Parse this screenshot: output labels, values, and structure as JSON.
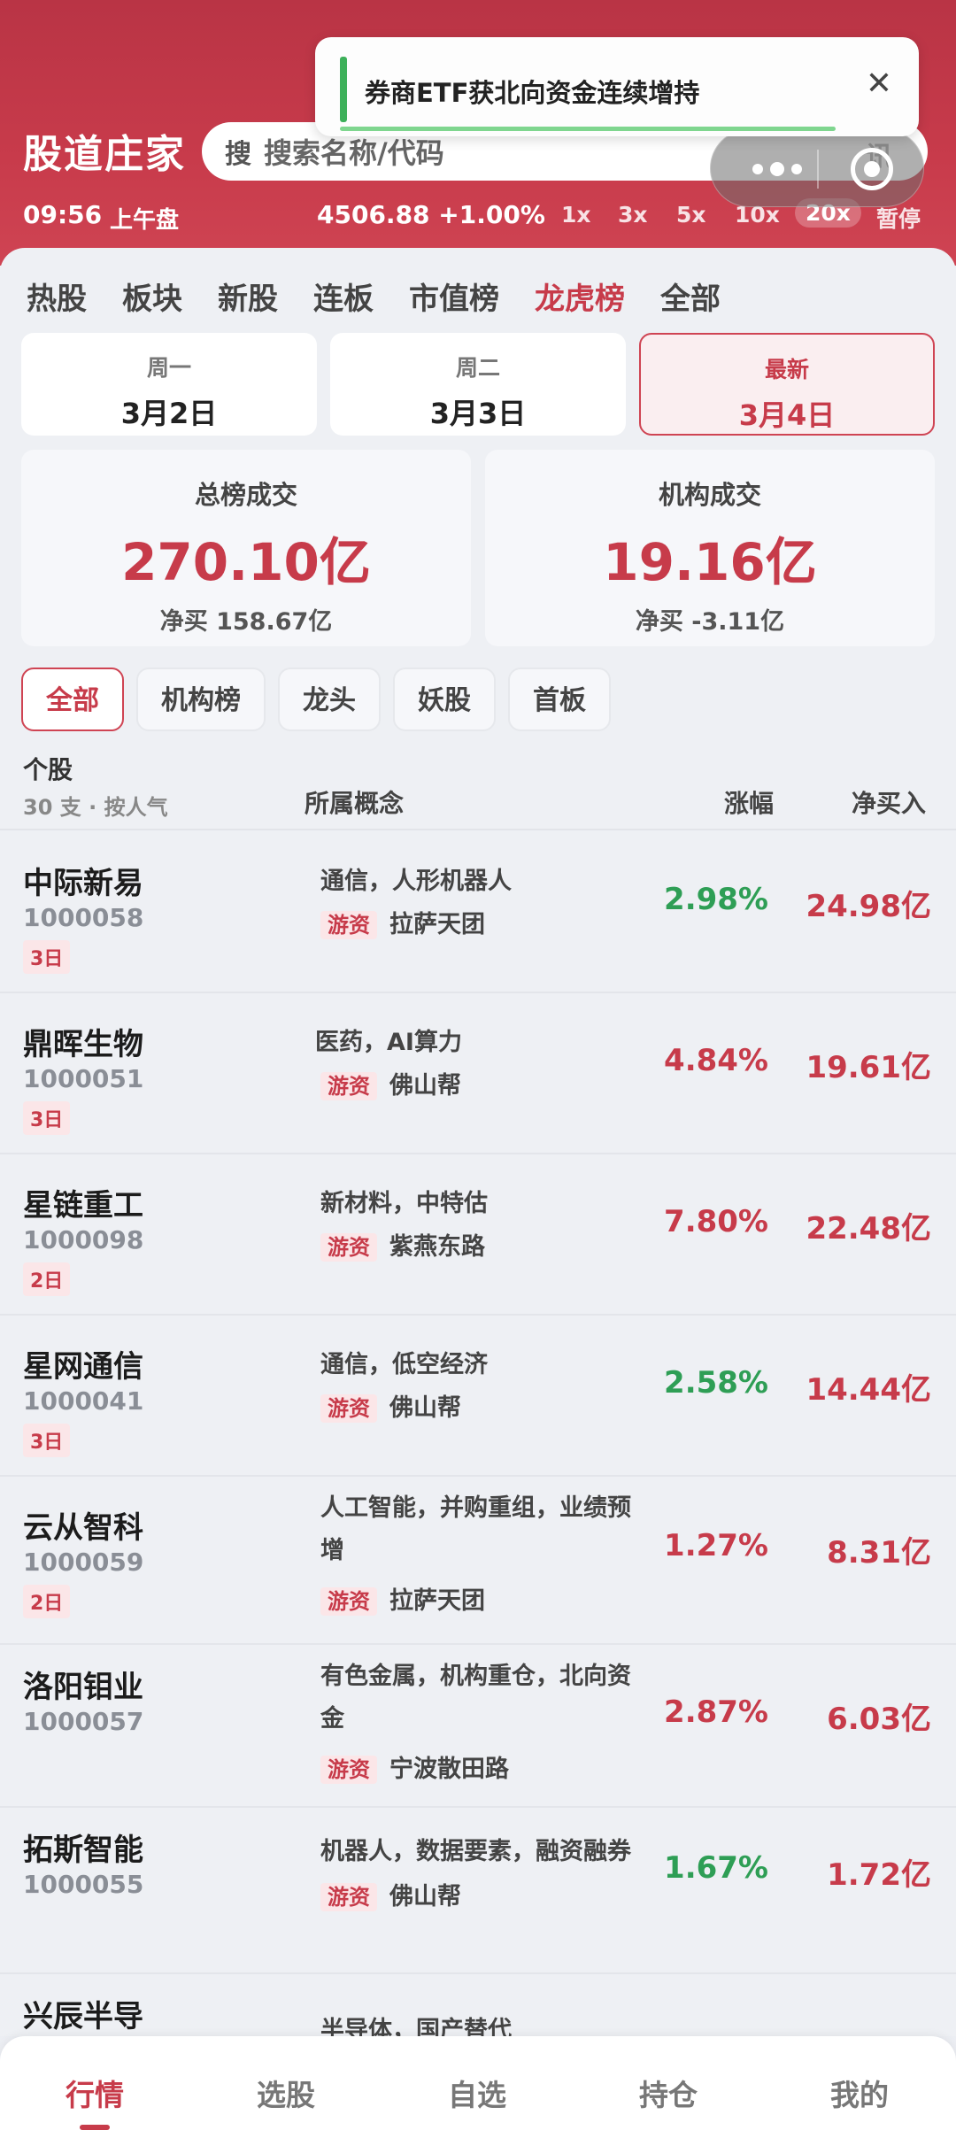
{
  "header": {
    "brand": "股道庄家",
    "search_icon": "搜",
    "search_placeholder": "搜索名称/代码",
    "news_label": "讯",
    "time": "09:56",
    "session": "上午盘",
    "index": "4506.88 +1.00%",
    "speeds": [
      "1x",
      "3x",
      "5x",
      "10x",
      "20x",
      "暂停"
    ],
    "active_speed": "20x"
  },
  "toast": {
    "text": "券商ETF获北向资金连续增持",
    "close_icon": "close-icon"
  },
  "tabs": [
    "热股",
    "板块",
    "新股",
    "连板",
    "市值榜",
    "龙虎榜",
    "全部"
  ],
  "active_tab": "龙虎榜",
  "dates": [
    {
      "weekday": "周一",
      "date": "3月2日"
    },
    {
      "weekday": "周二",
      "date": "3月3日"
    },
    {
      "weekday": "最新",
      "date": "3月4日"
    }
  ],
  "stats": {
    "total": {
      "label": "总榜成交",
      "value": "270.10亿",
      "net": "净买 158.67亿"
    },
    "institution": {
      "label": "机构成交",
      "value": "19.16亿",
      "net": "净买 -3.11亿"
    }
  },
  "filters": [
    "全部",
    "机构榜",
    "龙头",
    "妖股",
    "首板"
  ],
  "table": {
    "col_stock": "个股",
    "meta": "30 支 · 按人气",
    "col_concept": "所属概念",
    "col_change": "涨幅",
    "col_net": "净买入"
  },
  "rows": [
    {
      "name": "中际新易",
      "code": "1000058",
      "days": "3日",
      "concept": "通信，人形机器人",
      "seat_tag": "游资",
      "seat": "拉萨天团",
      "change": "2.98%",
      "change_dir": "down",
      "net": "24.98亿"
    },
    {
      "name": "鼎晖生物",
      "code": "1000051",
      "days": "3日",
      "concept": "医药，AI算力",
      "seat_tag": "游资",
      "seat": "佛山帮",
      "change": "4.84%",
      "change_dir": "up",
      "net": "19.61亿"
    },
    {
      "name": "星链重工",
      "code": "1000098",
      "days": "2日",
      "concept": "新材料，中特估",
      "seat_tag": "游资",
      "seat": "紫燕东路",
      "change": "7.80%",
      "change_dir": "up",
      "net": "22.48亿"
    },
    {
      "name": "星网通信",
      "code": "1000041",
      "days": "3日",
      "concept": "通信，低空经济",
      "seat_tag": "游资",
      "seat": "佛山帮",
      "change": "2.58%",
      "change_dir": "down",
      "net": "14.44亿"
    },
    {
      "name": "云从智科",
      "code": "1000059",
      "days": "2日",
      "concept": "人工智能，并购重组，业绩预增",
      "seat_tag": "游资",
      "seat": "拉萨天团",
      "change": "1.27%",
      "change_dir": "up",
      "net": "8.31亿"
    },
    {
      "name": "洛阳钼业",
      "code": "1000057",
      "days": "",
      "concept": "有色金属，机构重仓，北向资金",
      "seat_tag": "游资",
      "seat": "宁波散田路",
      "change": "2.87%",
      "change_dir": "up",
      "net": "6.03亿"
    },
    {
      "name": "拓斯智能",
      "code": "1000055",
      "days": "",
      "concept": "机器人，数据要素，融资融券",
      "seat_tag": "游资",
      "seat": "佛山帮",
      "change": "1.67%",
      "change_dir": "down",
      "net": "1.72亿"
    },
    {
      "name": "兴辰半导",
      "code": "",
      "days": "",
      "concept": "半导体，国产替代",
      "seat_tag": "",
      "seat": "",
      "change": "",
      "change_dir": "up",
      "net": ""
    }
  ],
  "bottom_nav": [
    "行情",
    "选股",
    "自选",
    "持仓",
    "我的"
  ],
  "colors": {
    "accent": "#c73b4a",
    "up": "#c73b4a",
    "down": "#2e9e55",
    "header": "#c83b4b"
  }
}
